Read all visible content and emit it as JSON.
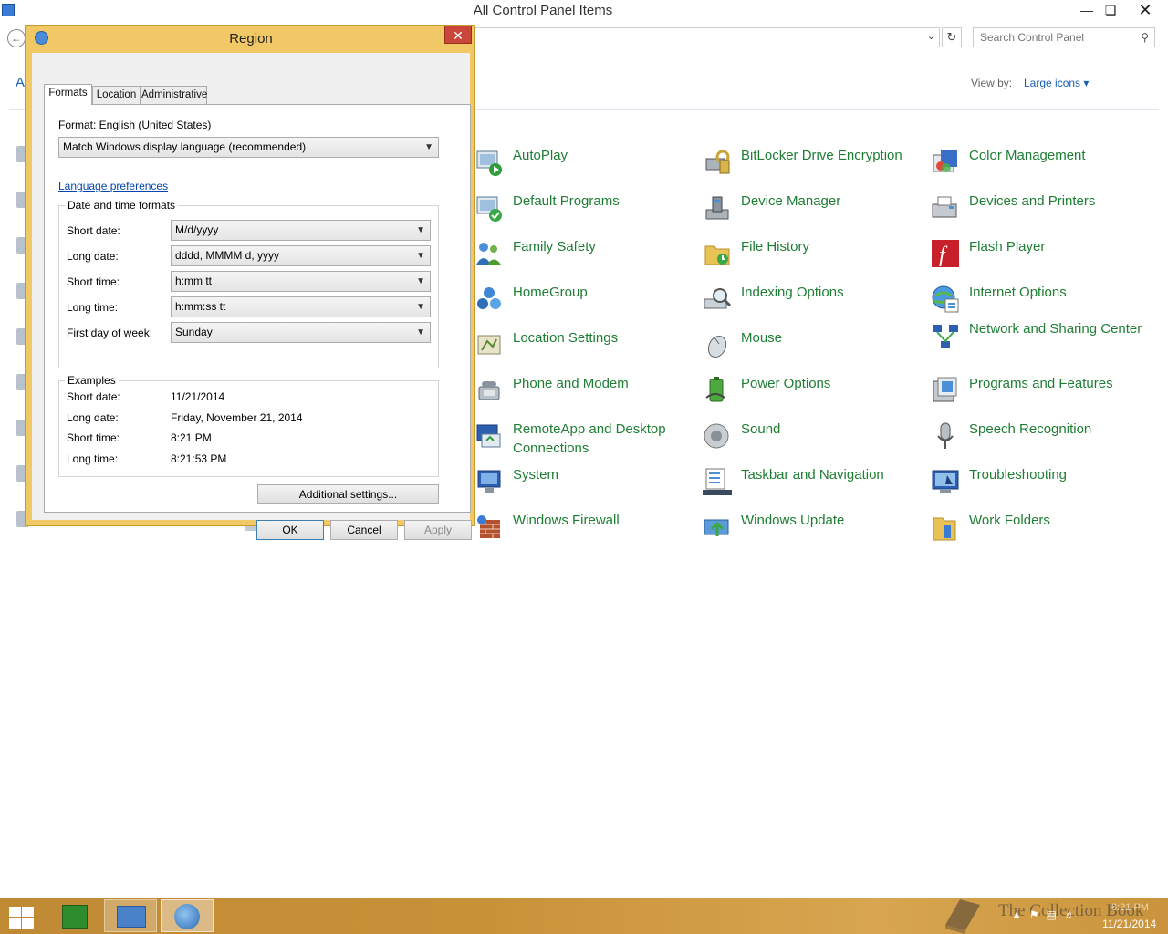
{
  "cp_window": {
    "title": "All Control Panel Items",
    "search_placeholder": "Search Control Panel",
    "view_by_label": "View by:",
    "view_by_value": "Large icons",
    "left_letter": "A",
    "items": [
      {
        "label": "AutoPlay",
        "icon": "autoplay-icon"
      },
      {
        "label": "BitLocker Drive Encryption",
        "icon": "bitlocker-icon"
      },
      {
        "label": "Color Management",
        "icon": "color-management-icon"
      },
      {
        "label": "Default Programs",
        "icon": "default-programs-icon"
      },
      {
        "label": "Device Manager",
        "icon": "device-manager-icon"
      },
      {
        "label": "Devices and Printers",
        "icon": "devices-printers-icon"
      },
      {
        "label": "Family Safety",
        "icon": "family-safety-icon"
      },
      {
        "label": "File History",
        "icon": "file-history-icon"
      },
      {
        "label": "Flash Player",
        "icon": "flash-player-icon"
      },
      {
        "label": "HomeGroup",
        "icon": "homegroup-icon"
      },
      {
        "label": "Indexing Options",
        "icon": "indexing-options-icon"
      },
      {
        "label": "Internet Options",
        "icon": "internet-options-icon"
      },
      {
        "label": "Location Settings",
        "icon": "location-settings-icon"
      },
      {
        "label": "Mouse",
        "icon": "mouse-icon"
      },
      {
        "label": "Network and Sharing Center",
        "icon": "network-sharing-icon"
      },
      {
        "label": "Phone and Modem",
        "icon": "phone-modem-icon"
      },
      {
        "label": "Power Options",
        "icon": "power-options-icon"
      },
      {
        "label": "Programs and Features",
        "icon": "programs-features-icon"
      },
      {
        "label": "RemoteApp and Desktop Connections",
        "icon": "remoteapp-icon"
      },
      {
        "label": "Sound",
        "icon": "sound-icon"
      },
      {
        "label": "Speech Recognition",
        "icon": "speech-recognition-icon"
      },
      {
        "label": "System",
        "icon": "system-icon"
      },
      {
        "label": "Taskbar and Navigation",
        "icon": "taskbar-navigation-icon"
      },
      {
        "label": "Troubleshooting",
        "icon": "troubleshooting-icon"
      },
      {
        "label": "Windows Firewall",
        "icon": "windows-firewall-icon"
      },
      {
        "label": "Windows Update",
        "icon": "windows-update-icon"
      },
      {
        "label": "Work Folders",
        "icon": "work-folders-icon"
      }
    ]
  },
  "region_dialog": {
    "title": "Region",
    "tabs": [
      "Formats",
      "Location",
      "Administrative"
    ],
    "format_label": "Format: English (United States)",
    "format_value": "Match Windows display language (recommended)",
    "language_link": "Language preferences",
    "dt_group_title": "Date and time formats",
    "dt_rows": [
      {
        "label": "Short date:",
        "value": "M/d/yyyy"
      },
      {
        "label": "Long date:",
        "value": "dddd, MMMM d, yyyy"
      },
      {
        "label": "Short time:",
        "value": "h:mm tt"
      },
      {
        "label": "Long time:",
        "value": "h:mm:ss tt"
      },
      {
        "label": "First day of week:",
        "value": "Sunday"
      }
    ],
    "examples_title": "Examples",
    "examples": [
      {
        "label": "Short date:",
        "value": "11/21/2014"
      },
      {
        "label": "Long date:",
        "value": "Friday, November 21, 2014"
      },
      {
        "label": "Short time:",
        "value": "8:21 PM"
      },
      {
        "label": "Long time:",
        "value": "8:21:53 PM"
      }
    ],
    "additional_button": "Additional settings...",
    "ok_button": "OK",
    "cancel_button": "Cancel",
    "apply_button": "Apply"
  },
  "taskbar": {
    "watermark": "The Collection Book",
    "time": "8:21 PM",
    "date": "11/21/2014"
  },
  "colors": {
    "dialog_frame": "#f0c865",
    "link_green": "#1e7e34",
    "taskbar": "#c89138"
  }
}
